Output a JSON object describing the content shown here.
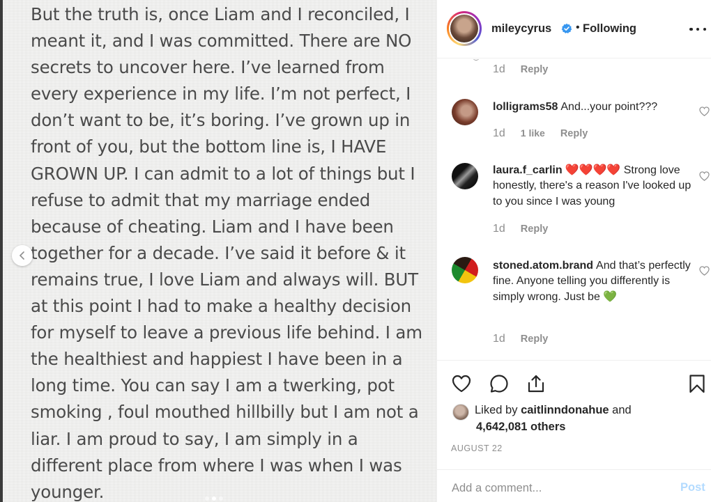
{
  "post": {
    "text": "But the truth is, once Liam and I reconciled, I\nmeant it, and I was committed. There are NO\nsecrets to uncover here. I’ve learned from\nevery experience in my life. I’m not perfect, I\ndon’t want to be, it’s boring. I’ve grown up in\nfront of you, but the bottom line is, I HAVE\nGROWN UP. I can admit to a lot of things but I\nrefuse to admit that my marriage ended\nbecause of cheating. Liam and I have been\ntogether for a decade. I’ve said it before & it\nremains true, I love Liam and always will. BUT\nat this point I had to make a healthy decision\nfor myself to leave a previous life behind. I am\nthe healthiest and happiest I have been in a\nlong time.  You can say I am a twerking, pot\nsmoking , foul mouthed hillbilly but I am not a\nliar. I am proud to say, I am simply in a\ndifferent place from where I was when I was\nyounger.",
    "prev_icon": "chevron-left-icon"
  },
  "header": {
    "username": "mileycyrus",
    "verified_icon": "verified-badge-icon",
    "separator": "•",
    "follow_status": "Following",
    "more_icon": "more-options-icon"
  },
  "comments": [
    {
      "id": "partial",
      "time": "1d",
      "reply_label": "Reply"
    },
    {
      "id": "lolligrams58",
      "username": "lolligrams58",
      "text": "And...your point???",
      "time": "1d",
      "likes": "1 like",
      "reply_label": "Reply"
    },
    {
      "id": "laura",
      "username": "laura.f_carlin",
      "text": "❤️❤️❤️❤️ Strong love honestly, there's a reason I've looked up to you since I was young",
      "time": "1d",
      "reply_label": "Reply"
    },
    {
      "id": "stoned",
      "username": "stoned.atom.brand",
      "text": "And that’s perfectly fine. Anyone telling you differently is simply wrong. Just be 💚",
      "time": "1d",
      "reply_label": "Reply"
    }
  ],
  "actions": {
    "like_icon": "heart-icon",
    "comment_icon": "comment-icon",
    "share_icon": "share-icon",
    "save_icon": "bookmark-icon",
    "liked_by_prefix": "Liked by",
    "liked_by_user": "caitlinndonahue",
    "liked_by_and": "and",
    "others": "4,642,081 others",
    "date": "AUGUST 22"
  },
  "add_comment": {
    "placeholder": "Add a comment...",
    "post_label": "Post"
  },
  "colors": {
    "text": "#262626",
    "muted": "#8e8e8e",
    "verified": "#3897f0",
    "post_disabled": "#b3dbff",
    "heart_red": "#e0245e",
    "heart_green": "#44c767"
  }
}
